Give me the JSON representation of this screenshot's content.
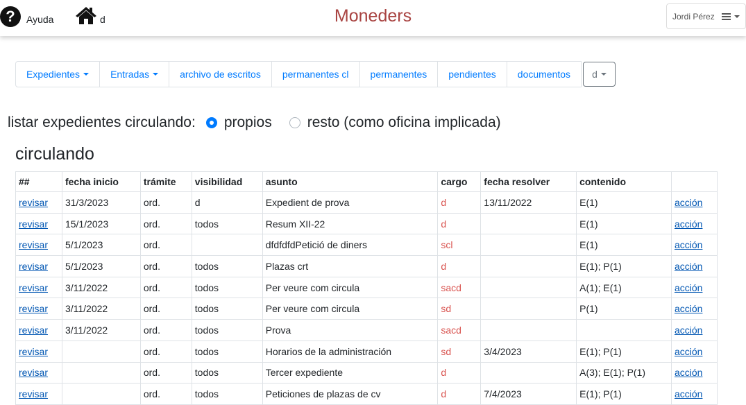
{
  "header": {
    "help_label": "Ayuda",
    "help_icon": "question-circle-icon",
    "home_label": "d",
    "home_icon": "home-icon",
    "title": "Moneders",
    "title_color": "#a94442",
    "user_name": "Jordi Pérez",
    "menu_icon": "hamburger-icon"
  },
  "nav": {
    "items": [
      {
        "label": "Expedientes",
        "dropdown": true
      },
      {
        "label": "Entradas",
        "dropdown": true
      },
      {
        "label": "archivo de escritos",
        "dropdown": false
      },
      {
        "label": "permanentes cl",
        "dropdown": false
      },
      {
        "label": "permanentes",
        "dropdown": false
      },
      {
        "label": "pendientes",
        "dropdown": false
      },
      {
        "label": "documentos",
        "dropdown": false
      }
    ],
    "select_value": "d",
    "link_color": "#007bff"
  },
  "filter": {
    "label": "listar expedientes circulando:",
    "options": [
      {
        "label": "propios",
        "checked": true
      },
      {
        "label": "resto (como oficina implicada)",
        "checked": false
      }
    ]
  },
  "section_title": "circulando",
  "table": {
    "headers": [
      "##",
      "fecha inicio",
      "trámite",
      "visibilidad",
      "asunto",
      "cargo",
      "fecha resolver",
      "contenido",
      ""
    ],
    "rows": [
      [
        "revisar",
        "31/3/2023",
        "ord.",
        "d",
        "Expedient de prova",
        "d",
        "13/11/2022",
        "E(1)",
        "acción"
      ],
      [
        "revisar",
        "15/1/2023",
        "ord.",
        "todos",
        "Resum XII-22",
        "d",
        "",
        "E(1)",
        "acción"
      ],
      [
        "revisar",
        "5/1/2023",
        "ord.",
        "",
        "dfdfdfdPetició de diners",
        "scl",
        "",
        "E(1)",
        "acción"
      ],
      [
        "revisar",
        "5/1/2023",
        "ord.",
        "todos",
        "Plazas crt",
        "d",
        "",
        "E(1); P(1)",
        "acción"
      ],
      [
        "revisar",
        "3/11/2022",
        "ord.",
        "todos",
        "Per veure com circula",
        "sacd",
        "",
        "A(1); E(1)",
        "acción"
      ],
      [
        "revisar",
        "3/11/2022",
        "ord.",
        "todos",
        "Per veure com circula",
        "sd",
        "",
        "P(1)",
        "acción"
      ],
      [
        "revisar",
        "3/11/2022",
        "ord.",
        "todos",
        "Prova",
        "sacd",
        "",
        "",
        "acción"
      ],
      [
        "revisar",
        "",
        "ord.",
        "todos",
        "Horarios de la administración",
        "sd",
        "3/4/2023",
        "E(1); P(1)",
        "acción"
      ],
      [
        "revisar",
        "",
        "ord.",
        "todos",
        "Tercer expediente",
        "d",
        "",
        "A(3); E(1); P(1)",
        "acción"
      ],
      [
        "revisar",
        "",
        "ord.",
        "todos",
        "Peticiones de plazas de cv",
        "d",
        "7/4/2023",
        "E(1); P(1)",
        "acción"
      ]
    ],
    "cargo_color": "#d9534f"
  }
}
